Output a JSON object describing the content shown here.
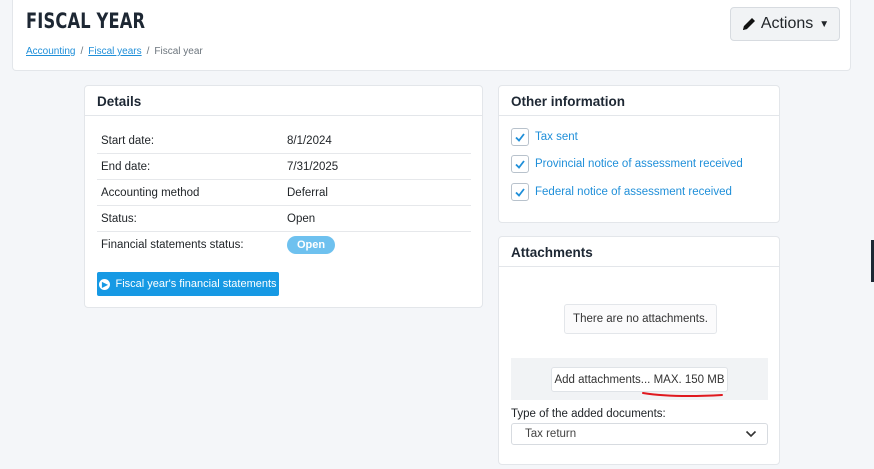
{
  "header": {
    "title": "FISCAL YEAR",
    "breadcrumb": [
      "Accounting",
      "Fiscal years",
      "Fiscal year"
    ],
    "actions_label": "Actions",
    "actions_icon": "pencil-icon"
  },
  "details": {
    "title": "Details",
    "rows": [
      {
        "label": "Start date:",
        "value": "8/1/2024"
      },
      {
        "label": "End date:",
        "value": "7/31/2025"
      },
      {
        "label": "Accounting method",
        "value": "Deferral"
      },
      {
        "label": "Status:",
        "value": "Open"
      },
      {
        "label": "Financial statements status:",
        "value": "Open"
      }
    ],
    "badge_color": "#6ec1ef",
    "button_label": "Fiscal year's financial statements",
    "button_color": "#1699e4"
  },
  "other": {
    "title": "Other information",
    "items": [
      {
        "label": "Tax sent",
        "checked": true
      },
      {
        "label": "Provincial notice of assessment received",
        "checked": true
      },
      {
        "label": "Federal notice of assessment received",
        "checked": true
      }
    ]
  },
  "attachments": {
    "title": "Attachments",
    "empty_text": "There are no attachments.",
    "add_label": "Add attachments... MAX. 150 MB",
    "type_label": "Type of the added documents:",
    "type_value": "Tax return"
  },
  "colors": {
    "link": "#1f8fd9",
    "annotation": "#e0191f"
  }
}
